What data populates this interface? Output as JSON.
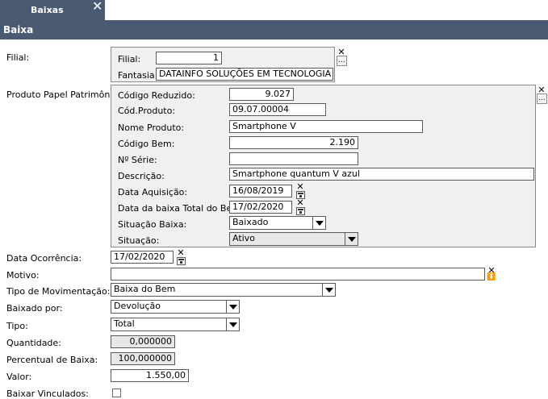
{
  "tab": {
    "label": "Baixas"
  },
  "header": {
    "title": "Baixa"
  },
  "filial": {
    "label": "Filial:",
    "filial_label": "Filial:",
    "filial_value": "1",
    "fantasia_label": "Fantasia:",
    "fantasia_value": "DATAINFO SOLUÇÕES EM TECNOLOGIA DA II",
    "more_label": "..."
  },
  "produto": {
    "label": "Produto Papel Patrimônio:",
    "more_label": "...",
    "codigo_reduzido_label": "Código Reduzido:",
    "codigo_reduzido_value": "9.027",
    "cod_produto_label": "Cód.Produto:",
    "cod_produto_value": "09.07.00004",
    "nome_produto_label": "Nome Produto:",
    "nome_produto_value": "Smartphone V",
    "codigo_bem_label": "Código Bem:",
    "codigo_bem_value": "2.190",
    "numero_serie_label": "Nº Série:",
    "numero_serie_value": "",
    "descricao_label": "Descrição:",
    "descricao_value": "Smartphone quantum V azul",
    "data_aquisicao_label": "Data Aquisição:",
    "data_aquisicao_value": "16/08/2019",
    "data_baixa_total_label": "Data da baixa Total do Bem:",
    "data_baixa_total_value": "17/02/2020",
    "situacao_baixa_label": "Situação Baixa:",
    "situacao_baixa_value": "Baixado",
    "situacao_label": "Situação:",
    "situacao_value": "Ativo"
  },
  "form": {
    "data_ocorrencia_label": "Data Ocorrência:",
    "data_ocorrencia_value": "17/02/2020",
    "motivo_label": "Motivo:",
    "motivo_value": "",
    "tipo_movimentacao_label": "Tipo de Movimentação:",
    "tipo_movimentacao_value": "Baixa do Bem",
    "baixado_por_label": "Baixado por:",
    "baixado_por_value": "Devolução",
    "tipo_label": "Tipo:",
    "tipo_value": "Total",
    "quantidade_label": "Quantidade:",
    "quantidade_value": "0,000000",
    "percentual_label": "Percentual de Baixa:",
    "percentual_value": "100,000000",
    "valor_label": "Valor:",
    "valor_value": "1.550,00",
    "baixar_vinculados_label": "Baixar Vinculados:"
  },
  "icons": {
    "close": "close-icon",
    "clear": "x-icon",
    "more": "ellipsis-icon",
    "calendar": "calendar-icon",
    "dropdown": "chevron-down-icon",
    "expand": "double-chevron-down-icon"
  },
  "colors": {
    "header_bg": "#4a5a72",
    "group_bg": "#f0f0f0",
    "readonly_bg": "#e8e8e8"
  }
}
